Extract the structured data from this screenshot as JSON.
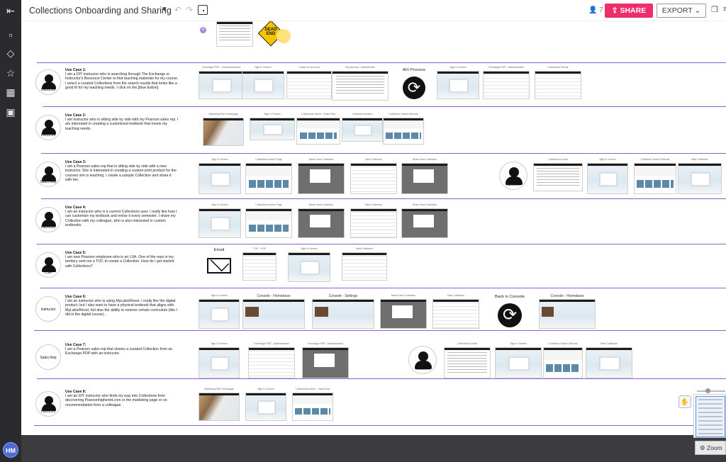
{
  "board": {
    "title": "Collections Onboarding and Sharing",
    "collaborators": "7",
    "share_label": "SHARE",
    "export_label": "EXPORT"
  },
  "user_initials": "HM",
  "zoom_label": "Zoom",
  "colors": {
    "share": "#ee2d6a",
    "divider": "#8f5fd3",
    "rail": "#2b2b2f",
    "avatar": "#4a6ad8"
  },
  "top_fragment": {
    "badge": "4",
    "deadend": "DEAD END"
  },
  "use_cases": [
    {
      "title": "Use Case 1:",
      "role": "Instructor",
      "text": "I am a DIY instructor who is searching through The Exchange or Instructor's Resource Center to find teaching materials for my course. I select a curated Collections from the search results that looks like a good fit for my teaching needs. I click on the [blue button].",
      "steps": [
        "Exchange PDP - Unauthenticated",
        "Sign In Screen",
        "Create an Account",
        "My Account - Authenticate",
        "AIV Process",
        "Sign In Screen",
        "Exchange PDP - Authenticated",
        "Collections Result"
      ]
    },
    {
      "title": "Use Case 2:",
      "role": "Instructor",
      "text": "I am instructor who is sitting side by side with my Pearson sales rep. I am interested in creating a customized textbook that meets my teaching needs.",
      "steps": [
        "Marketing Site Homepage",
        "Sign In Screen",
        "Collections Home - Sales Rep",
        "Collection Search",
        "Collection Search Results"
      ]
    },
    {
      "title": "Use Case 3:",
      "role": "Sales Rep",
      "text": "I am a Pearson sales rep that is sitting side by side with a new instructor. She is interested in creating a custom print product for the courses she is teaching. I create a sample Collection and share it with her.",
      "steps": [
        "Sign In Screen",
        "Collections Home Page",
        "Name New Collection",
        "New Collection",
        "Share New Collection",
        "Instructor",
        "Collection's Invite",
        "Sign In Screen",
        "Collection Search Results",
        "New Collection"
      ]
    },
    {
      "title": "Use Case 4:",
      "role": "Instructor",
      "text": "I am an instructor who is a current Collections user. I really like how I can customize my textbook and revise it every semester. I share my Collection with my colleague, who is also interested in custom textbooks.",
      "steps": [
        "Sign In Screen",
        "Collections Home Page",
        "Name New Collection",
        "New Collection",
        "Share New Collection"
      ]
    },
    {
      "title": "Use Case 5:",
      "role": "LSA",
      "text": "I am new Pearson employee who is an LSA. One of the reps in my territory sent me a TOC to create a Collection. How do I get started with Collections?",
      "steps": [
        "Email",
        "TOC - PDF",
        "Sign In Screen",
        "New Collection"
      ]
    },
    {
      "title": "Use Case 6:",
      "role": "Instructor",
      "text": "I am an instructor who is using MyLabs/Revel. I really like the digital product, but I also want to have a physical textbook that aligns with MyLabs/Revel, but also the ability to remove certain curriculum (like I did in the digital course).",
      "steps": [
        "Sign In Screen",
        "Console - Homebase",
        "Console - Settings",
        "Name New Collection",
        "New Collection",
        "Back in Console",
        "Console - Homebase"
      ]
    },
    {
      "title": "Use Case 7:",
      "role": "Sales Rep",
      "text": "I am a Pearson sales rep that shares a curated Collection from an Exchange PDP with an instructor.",
      "steps": [
        "Sign In Screen",
        "Exchange PDP - Authenticated",
        "Exchange PDP - Authenticated",
        "Instructor",
        "Collection's Invite",
        "Sign In Screen",
        "Collection Search Results",
        "New Collection"
      ]
    },
    {
      "title": "Use Case 8:",
      "role": "Instructor",
      "text": "I am an DIY instructor who finds my way into Collections from discovering Pearsonhighered.com or the marketing page or on recommendation from a colleague.",
      "steps": [
        "Marketing Site Homepage",
        "Sign In Screen",
        "Collections Home - Sales Rep"
      ]
    }
  ]
}
